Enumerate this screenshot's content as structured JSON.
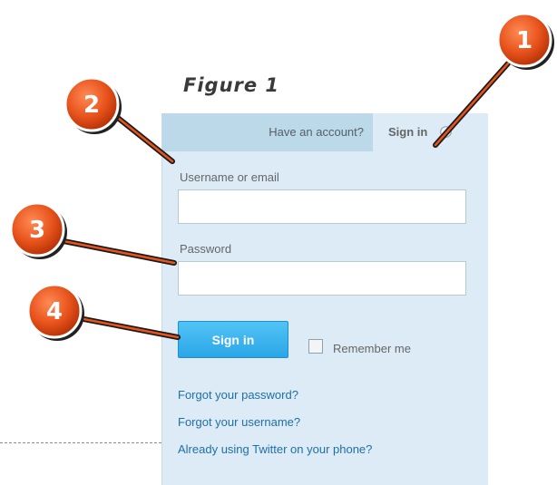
{
  "figure_label": "Figure 1",
  "tabs": {
    "have_account": "Have an account?",
    "sign_in": "Sign in"
  },
  "form": {
    "username_label": "Username or email",
    "username_value": "",
    "password_label": "Password",
    "password_value": "",
    "signin_button": "Sign in",
    "remember_me": "Remember me",
    "remember_checked": false
  },
  "links": {
    "forgot_password": "Forgot your password?",
    "forgot_username": "Forgot your username?",
    "twitter_phone": "Already using Twitter on your phone?"
  },
  "callouts": [
    "1",
    "2",
    "3",
    "4"
  ],
  "colors": {
    "callout_fill": "#e8531c",
    "panel_bg": "#dcebf5",
    "button_blue": "#2aa6e8",
    "link_blue": "#1f6fa8"
  }
}
